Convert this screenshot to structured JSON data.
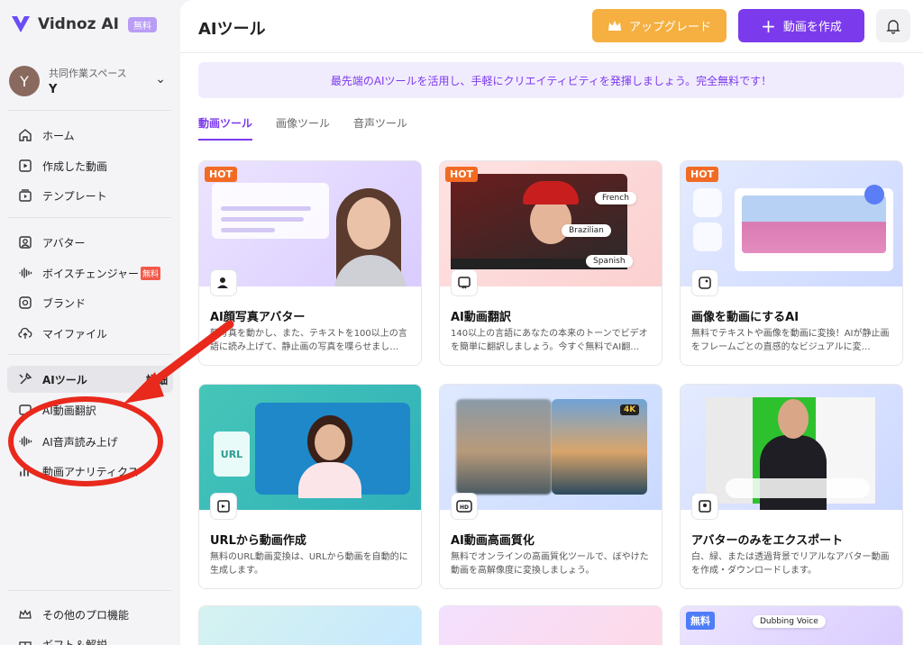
{
  "sidebar": {
    "logo_text": "Vidnoz AI",
    "logo_badge": "無料",
    "workspace": {
      "label": "共同作業スペース",
      "name": "Y",
      "avatar_initial": "Y"
    },
    "group1": [
      {
        "label": "ホーム",
        "icon": "home-icon"
      },
      {
        "label": "作成した動画",
        "icon": "video-icon"
      },
      {
        "label": "テンプレート",
        "icon": "template-icon"
      }
    ],
    "group2": [
      {
        "label": "アバター",
        "icon": "avatar-icon"
      },
      {
        "label": "ボイスチェンジャー",
        "icon": "voice-icon",
        "badge": "無料"
      },
      {
        "label": "ブランド",
        "icon": "brand-icon"
      },
      {
        "label": "マイファイル",
        "icon": "cloud-upload-icon"
      }
    ],
    "ai_tools": {
      "label": "AIツール",
      "detail": "詳細"
    },
    "sub_items": [
      {
        "label": "AI動画翻訳"
      },
      {
        "label": "AI音声読み上げ"
      },
      {
        "label": "動画アナリティクス"
      }
    ],
    "bottom": [
      {
        "label": "その他のプロ機能"
      },
      {
        "label": "ギフト＆解説"
      }
    ]
  },
  "header": {
    "title": "AIツール",
    "upgrade_label": "アップグレード",
    "create_label": "動画を作成"
  },
  "banner": "最先端のAIツールを活用し、手軽にクリエイティビティを発揮しましょう。完全無料です！",
  "tabs": [
    "動画ツール",
    "画像ツール",
    "音声ツール"
  ],
  "cards": [
    {
      "badge": "HOT",
      "title": "AI顔写真アバター",
      "desc": "顔写真を動かし、また、テキストを100以上の言語に読み上げて、静止画の写真を喋らせまし…"
    },
    {
      "badge": "HOT",
      "title": "AI動画翻訳",
      "desc": "140以上の言語にあなたの本来のトーンでビデオを簡単に翻訳しましょう。今すぐ無料でAI翻…",
      "languages": [
        "French",
        "Brazilian",
        "Spanish"
      ]
    },
    {
      "badge": "HOT",
      "title": "画像を動画にするAI",
      "desc": "無料でテキストや画像を動画に変換！AIが静止画をフレームごとの直感的なビジュアルに変…"
    },
    {
      "title": "URLから動画作成",
      "desc": "無料のURL動画変換は、URLから動画を自動的に生成します。",
      "thumb_label": "URL"
    },
    {
      "title": "AI動画高画質化",
      "desc": "無料でオンラインの高画質化ツールで、ぼやけた動画を高解像度に変換しましょう。",
      "thumb_label": "4K"
    },
    {
      "title": "アバターのみをエクスポート",
      "desc": "白、緑、または透過背景でリアルなアバター動画を作成・ダウンロードします。"
    }
  ],
  "partial_cards": [
    {
      "badge": ""
    },
    {
      "badge": ""
    },
    {
      "badge": "無料",
      "label": "Dubbing Voice"
    }
  ],
  "colors": {
    "accent": "#7c3aed",
    "upgrade": "#f5b041",
    "hot": "#f26b24",
    "annotation": "#e8291c"
  }
}
